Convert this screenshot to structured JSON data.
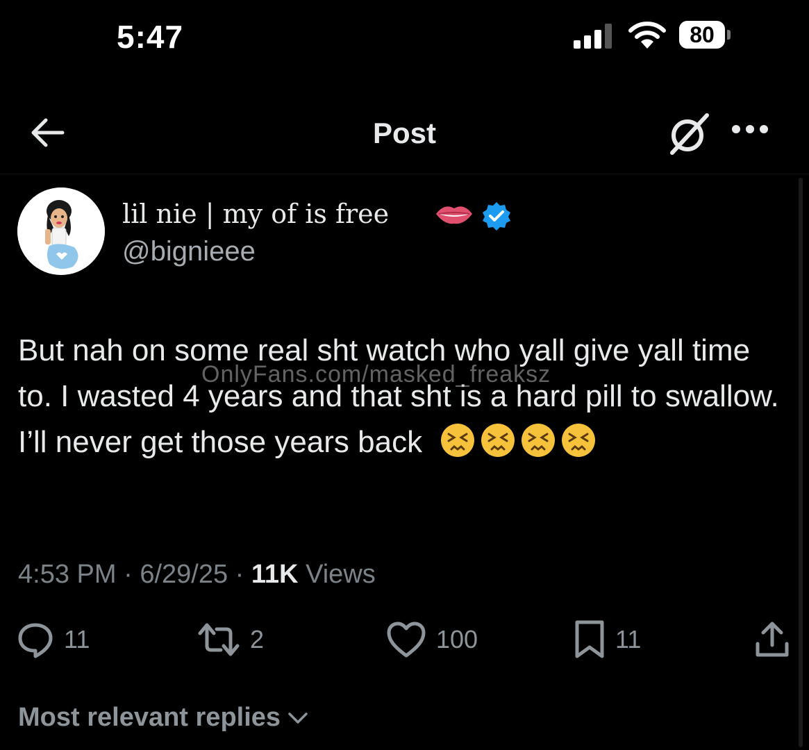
{
  "status_bar": {
    "time": "5:47",
    "battery": "80",
    "battery_level": 0.8
  },
  "nav": {
    "title": "Post"
  },
  "author": {
    "display_name": "lil nie | my of is free",
    "handle": "@bignieee",
    "verified": true
  },
  "tweet": {
    "text": "But nah on some real sht watch who yall give yall time to. I wasted 4 years and that sht is a hard pill to swallow. I’ll never get those years back",
    "trailing_emoji": [
      "persevering-face",
      "persevering-face",
      "persevering-face",
      "persevering-face"
    ]
  },
  "watermark": "OnlyFans.com/masked_freaksz",
  "meta": {
    "time": "4:53 PM",
    "sep1": "·",
    "date": "6/29/25",
    "sep2": "·",
    "views_count": "11K",
    "views_label": "Views"
  },
  "actions": {
    "replies": "11",
    "reposts": "2",
    "likes": "100",
    "bookmarks": "11"
  },
  "replies_sort": {
    "label": "Most relevant replies"
  },
  "colors": {
    "background": "#000000",
    "text": "#e7e9ea",
    "secondary": "#7c8388",
    "verified": "#1d9bf0"
  }
}
